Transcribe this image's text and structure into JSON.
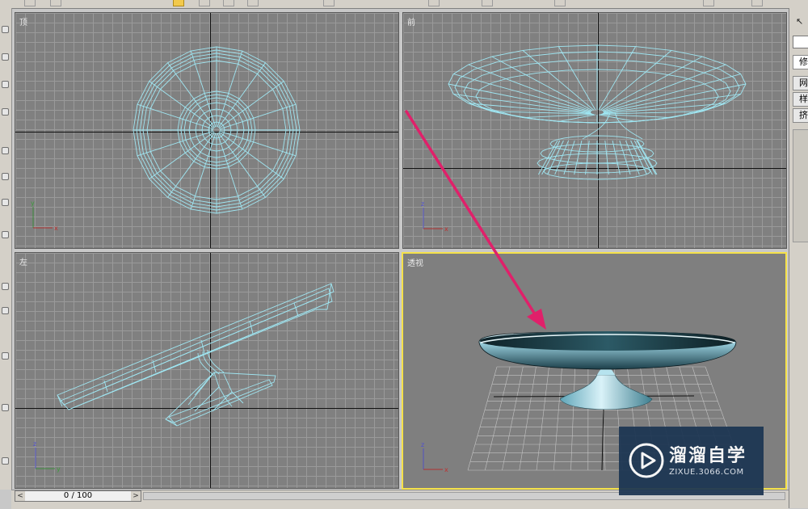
{
  "viewports": {
    "top": {
      "label": "顶"
    },
    "front": {
      "label": "前"
    },
    "left": {
      "label": "左"
    },
    "perspective": {
      "label": "透视",
      "active": true
    }
  },
  "command_panel": {
    "tab_label": "修改",
    "buttons": [
      "网",
      "样",
      "挤"
    ]
  },
  "time_slider": {
    "text": "0 / 100",
    "prev": "<",
    "next": ">"
  },
  "watermark": {
    "title": "溜溜自学",
    "url": "ZIXUE.3066.COM"
  },
  "colors": {
    "wire": "#9fe6f2",
    "viewport_bg": "#808080",
    "active_border": "#f5e14a",
    "arrow": "#e0206a"
  }
}
